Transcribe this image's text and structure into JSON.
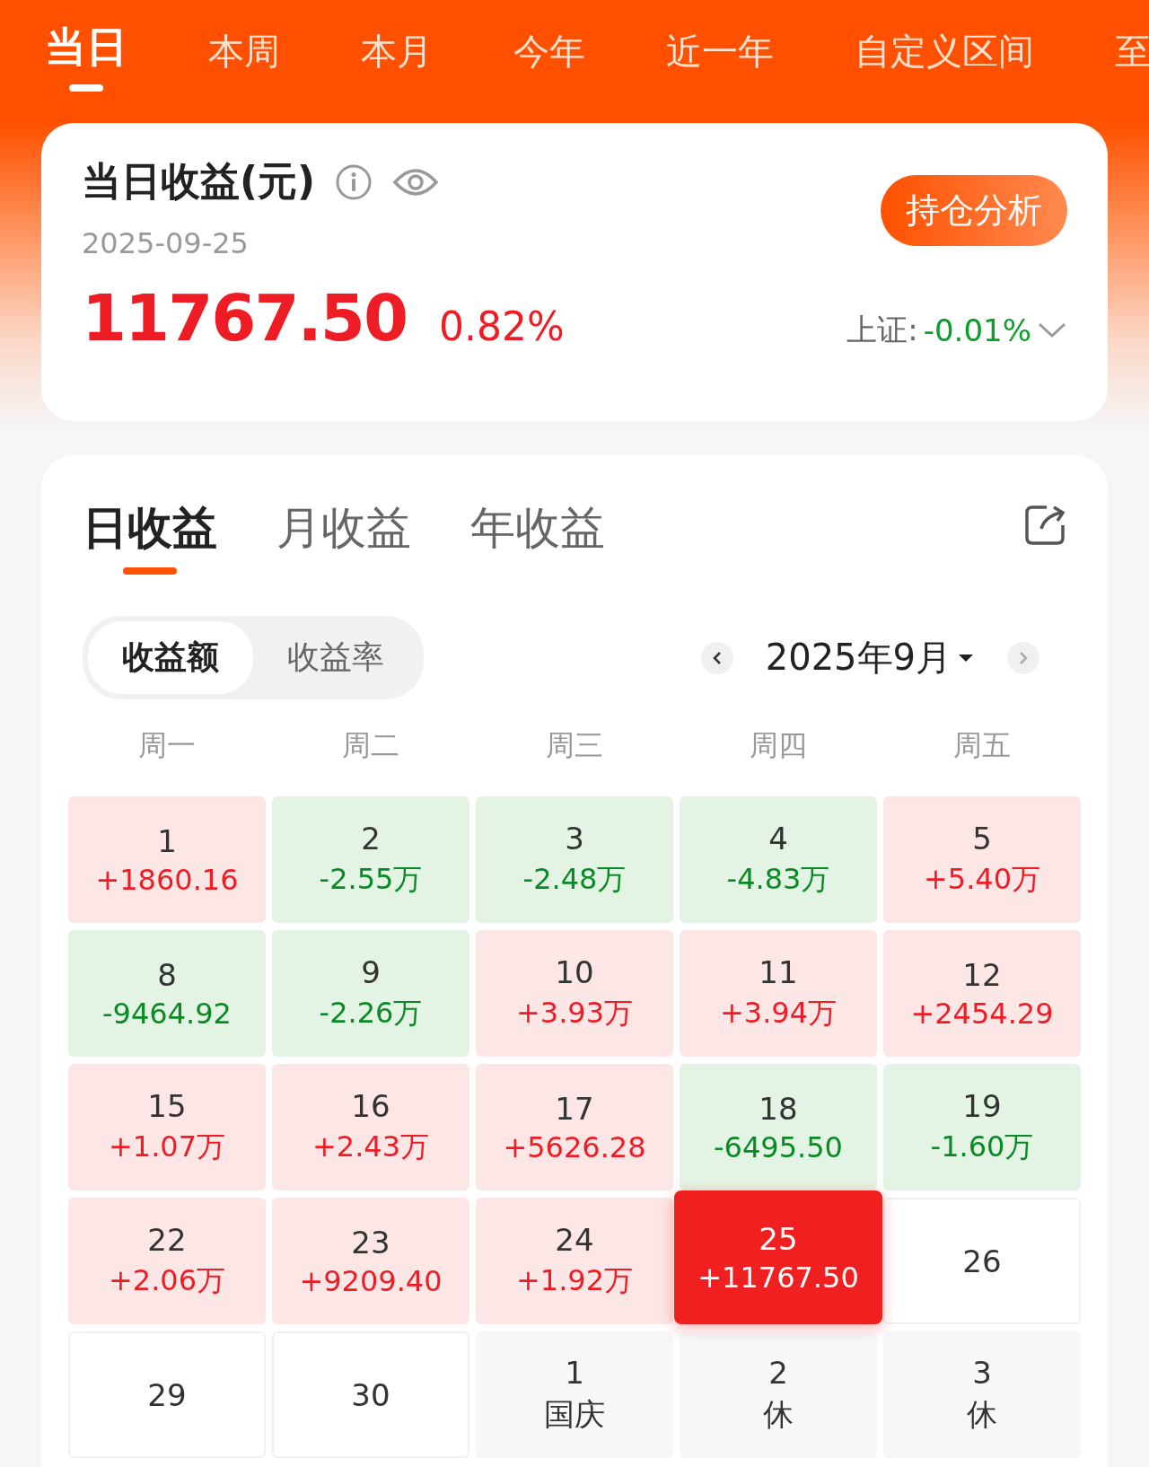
{
  "period_tabs": [
    {
      "label": "当日",
      "selected": true
    },
    {
      "label": "本周",
      "selected": false
    },
    {
      "label": "本月",
      "selected": false
    },
    {
      "label": "今年",
      "selected": false
    },
    {
      "label": "近一年",
      "selected": false
    },
    {
      "label": "自定义区间",
      "selected": false
    },
    {
      "label": "至",
      "selected": false
    }
  ],
  "summary": {
    "title": "当日收益(元)",
    "date": "2025-09-25",
    "amount": "11767.50",
    "percent": "0.82%",
    "button": "持仓分析",
    "index_label": "上证:",
    "index_value": "-0.01%"
  },
  "view_tabs": [
    {
      "label": "日收益",
      "selected": true
    },
    {
      "label": "月收益",
      "selected": false
    },
    {
      "label": "年收益",
      "selected": false
    }
  ],
  "mode_toggle": [
    {
      "label": "收益额",
      "selected": true
    },
    {
      "label": "收益率",
      "selected": false
    }
  ],
  "month": "2025年9月",
  "weekdays": [
    "周一",
    "周二",
    "周三",
    "周四",
    "周五"
  ],
  "days": [
    {
      "day": "1",
      "value": "+1860.16",
      "kind": "gain"
    },
    {
      "day": "2",
      "value": "-2.55万",
      "kind": "loss"
    },
    {
      "day": "3",
      "value": "-2.48万",
      "kind": "loss"
    },
    {
      "day": "4",
      "value": "-4.83万",
      "kind": "loss"
    },
    {
      "day": "5",
      "value": "+5.40万",
      "kind": "gain"
    },
    {
      "day": "8",
      "value": "-9464.92",
      "kind": "loss"
    },
    {
      "day": "9",
      "value": "-2.26万",
      "kind": "loss"
    },
    {
      "day": "10",
      "value": "+3.93万",
      "kind": "gain"
    },
    {
      "day": "11",
      "value": "+3.94万",
      "kind": "gain"
    },
    {
      "day": "12",
      "value": "+2454.29",
      "kind": "gain"
    },
    {
      "day": "15",
      "value": "+1.07万",
      "kind": "gain"
    },
    {
      "day": "16",
      "value": "+2.43万",
      "kind": "gain"
    },
    {
      "day": "17",
      "value": "+5626.28",
      "kind": "gain"
    },
    {
      "day": "18",
      "value": "-6495.50",
      "kind": "loss"
    },
    {
      "day": "19",
      "value": "-1.60万",
      "kind": "loss"
    },
    {
      "day": "22",
      "value": "+2.06万",
      "kind": "gain"
    },
    {
      "day": "23",
      "value": "+9209.40",
      "kind": "gain"
    },
    {
      "day": "24",
      "value": "+1.92万",
      "kind": "gain"
    },
    {
      "day": "25",
      "value": "+11767.50",
      "kind": "today"
    },
    {
      "day": "26",
      "kind": "empty"
    },
    {
      "day": "29",
      "kind": "empty"
    },
    {
      "day": "30",
      "kind": "empty"
    },
    {
      "day": "1",
      "value": "国庆",
      "kind": "holiday"
    },
    {
      "day": "2",
      "value": "休",
      "kind": "holiday"
    },
    {
      "day": "3",
      "value": "休",
      "kind": "holiday"
    }
  ]
}
